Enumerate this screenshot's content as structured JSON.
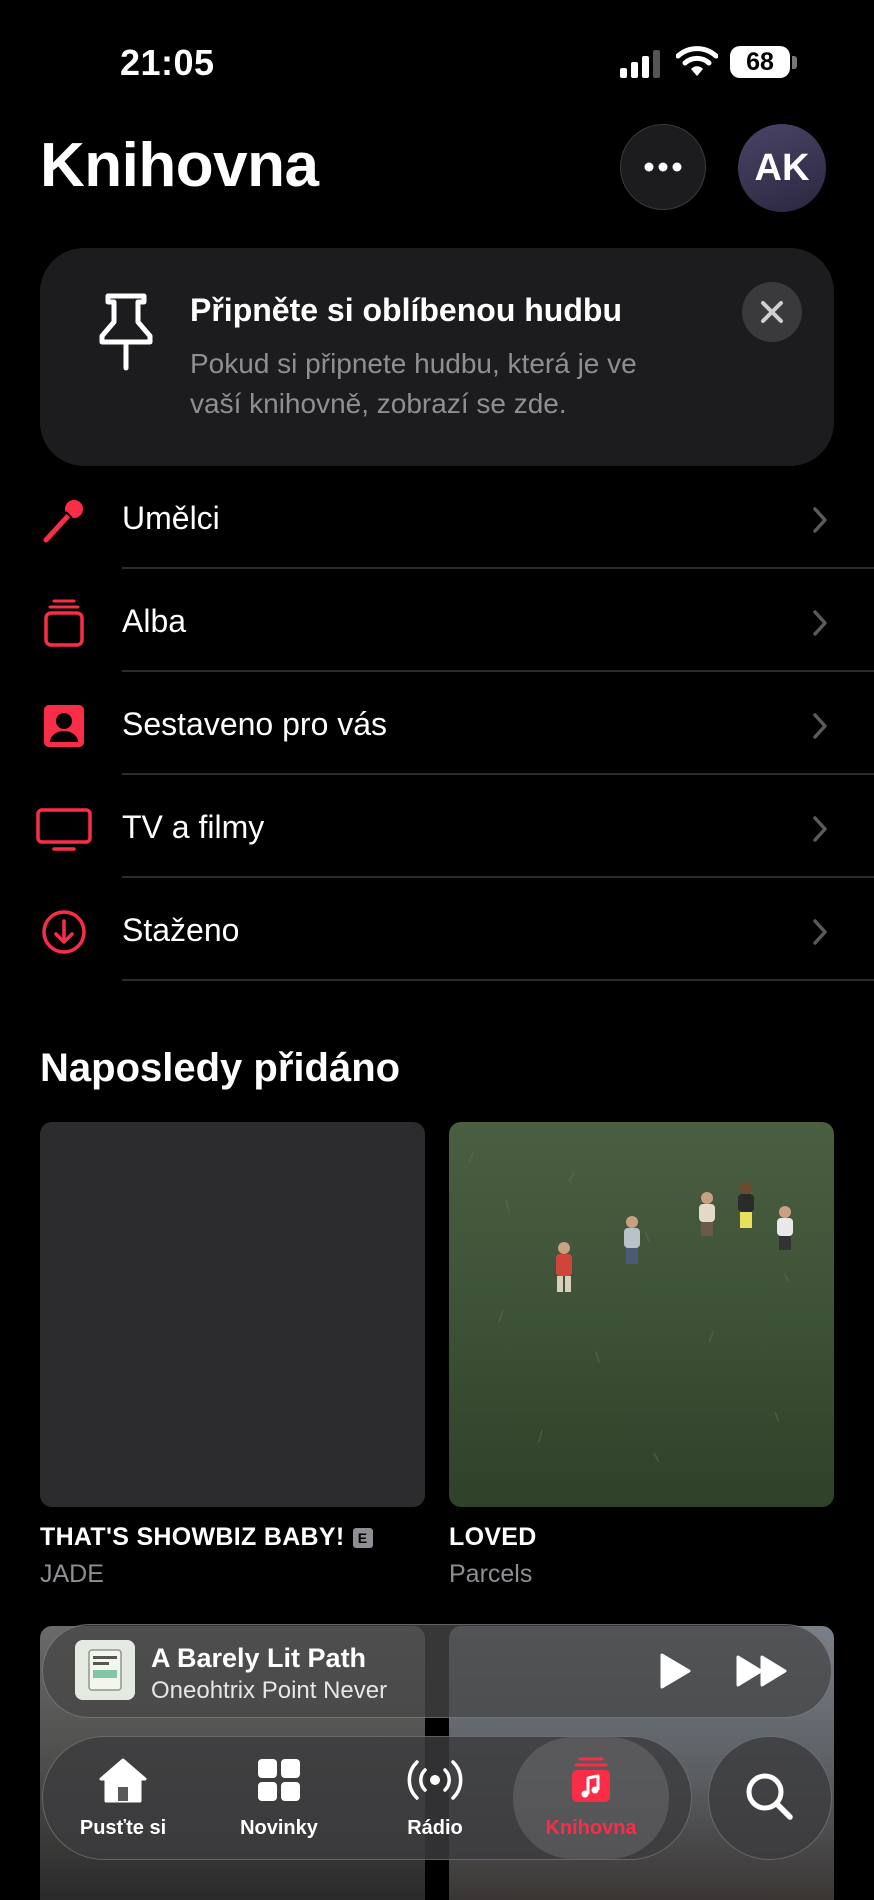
{
  "status_bar": {
    "time": "21:05",
    "battery": "68"
  },
  "header": {
    "title": "Knihovna",
    "avatar_initials": "AK"
  },
  "pin_card": {
    "title": "Připněte si oblíbenou hudbu",
    "description": "Pokud si připnete hudbu, která je ve vaší knihovně, zobrazí se zde."
  },
  "menu": {
    "items": [
      {
        "label": "Umělci",
        "icon": "microphone-icon"
      },
      {
        "label": "Alba",
        "icon": "album-stack-icon"
      },
      {
        "label": "Sestaveno pro vás",
        "icon": "person-square-icon"
      },
      {
        "label": "TV a filmy",
        "icon": "tv-icon"
      },
      {
        "label": "Staženo",
        "icon": "download-icon"
      }
    ]
  },
  "recently_added": {
    "title": "Naposledy přidáno",
    "albums": [
      {
        "title": "THAT'S SHOWBIZ BABY!",
        "artist": "JADE",
        "explicit": "E"
      },
      {
        "title": "LOVED",
        "artist": "Parcels"
      }
    ]
  },
  "now_playing": {
    "title": "A Barely Lit Path",
    "artist": "Oneohtrix Point Never"
  },
  "tabs": [
    {
      "label": "Pusťte si",
      "icon": "home-icon"
    },
    {
      "label": "Novinky",
      "icon": "grid-icon"
    },
    {
      "label": "Rádio",
      "icon": "radio-icon"
    },
    {
      "label": "Knihovna",
      "icon": "library-icon",
      "active": true
    }
  ],
  "colors": {
    "accent": "#fa2d48",
    "background": "#000000",
    "card": "#1c1c1e",
    "secondary_text": "#8e8e93"
  }
}
